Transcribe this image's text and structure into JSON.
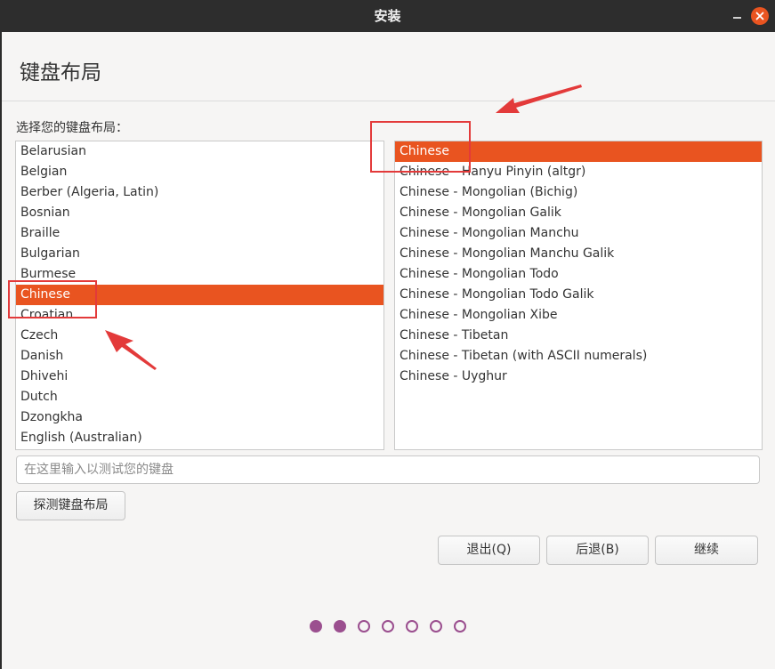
{
  "window": {
    "title": "安装"
  },
  "page": {
    "title": "键盘布局",
    "prompt": "选择您的键盘布局："
  },
  "layouts": [
    {
      "label": "Belarusian",
      "selected": false
    },
    {
      "label": "Belgian",
      "selected": false
    },
    {
      "label": "Berber (Algeria, Latin)",
      "selected": false
    },
    {
      "label": "Bosnian",
      "selected": false
    },
    {
      "label": "Braille",
      "selected": false
    },
    {
      "label": "Bulgarian",
      "selected": false
    },
    {
      "label": "Burmese",
      "selected": false
    },
    {
      "label": "Chinese",
      "selected": true
    },
    {
      "label": "Croatian",
      "selected": false
    },
    {
      "label": "Czech",
      "selected": false
    },
    {
      "label": "Danish",
      "selected": false
    },
    {
      "label": "Dhivehi",
      "selected": false
    },
    {
      "label": "Dutch",
      "selected": false
    },
    {
      "label": "Dzongkha",
      "selected": false
    },
    {
      "label": "English (Australian)",
      "selected": false
    }
  ],
  "variants": [
    {
      "label": "Chinese",
      "selected": true
    },
    {
      "label": "Chinese - Hanyu Pinyin (altgr)",
      "selected": false
    },
    {
      "label": "Chinese - Mongolian (Bichig)",
      "selected": false
    },
    {
      "label": "Chinese - Mongolian Galik",
      "selected": false
    },
    {
      "label": "Chinese - Mongolian Manchu",
      "selected": false
    },
    {
      "label": "Chinese - Mongolian Manchu Galik",
      "selected": false
    },
    {
      "label": "Chinese - Mongolian Todo",
      "selected": false
    },
    {
      "label": "Chinese - Mongolian Todo Galik",
      "selected": false
    },
    {
      "label": "Chinese - Mongolian Xibe",
      "selected": false
    },
    {
      "label": "Chinese - Tibetan",
      "selected": false
    },
    {
      "label": "Chinese - Tibetan (with ASCII numerals)",
      "selected": false
    },
    {
      "label": "Chinese - Uyghur",
      "selected": false
    }
  ],
  "test_input": {
    "placeholder": "在这里输入以测试您的键盘",
    "value": ""
  },
  "buttons": {
    "detect": "探测键盘布局",
    "quit": "退出(Q)",
    "back": "后退(B)",
    "continue": "继续"
  },
  "progress": {
    "total_steps": 7,
    "current_step": 2
  },
  "colors": {
    "accent": "#e95420",
    "progress": "#9b4f8f",
    "annotation": "#e33a3a",
    "titlebar": "#2d2d2d"
  },
  "icons": {
    "minimize": "minimize-icon",
    "close": "close-icon"
  }
}
